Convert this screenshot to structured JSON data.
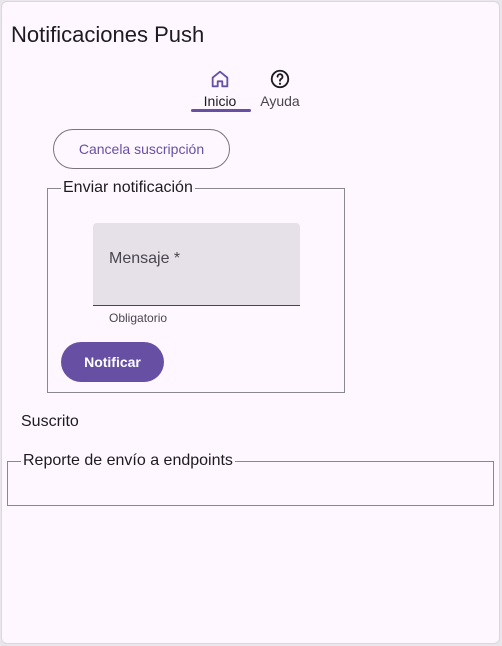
{
  "app": {
    "title": "Notificaciones Push"
  },
  "tabs": [
    {
      "label": "Inicio",
      "icon": "home-icon",
      "active": true
    },
    {
      "label": "Ayuda",
      "icon": "help-icon",
      "active": false
    }
  ],
  "subscription": {
    "cancel_label": "Cancela suscripción",
    "status": "Suscrito"
  },
  "send_panel": {
    "legend": "Enviar notificación",
    "message_field": {
      "label": "Mensaje *",
      "value": "",
      "support_text": "Obligatorio"
    },
    "notify_label": "Notificar"
  },
  "report_panel": {
    "legend": "Reporte de envío a endpoints"
  },
  "colors": {
    "primary": "#6750a4",
    "surface": "#fef7ff",
    "field_bg": "#e6e0e9"
  }
}
